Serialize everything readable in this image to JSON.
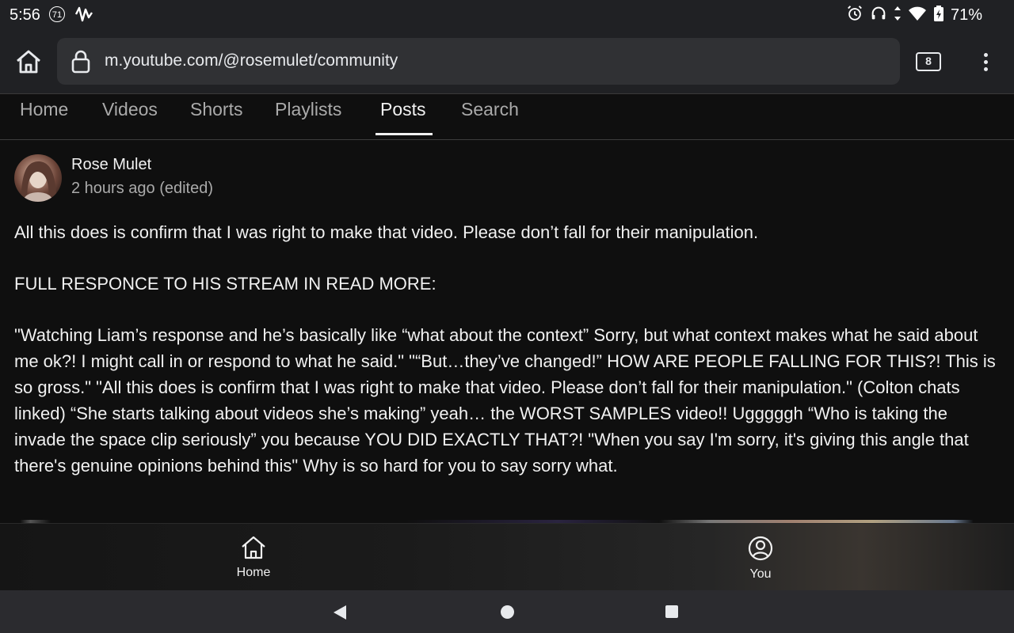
{
  "status_bar": {
    "time": "5:56",
    "notification_badge": "71",
    "battery": "71%",
    "icons": [
      "alarm-icon",
      "headphones-icon",
      "data-arrows-icon",
      "wifi-icon",
      "battery-charging-icon"
    ]
  },
  "browser": {
    "url": "m.youtube.com/@rosemulet/community",
    "tab_count": "8"
  },
  "channel_tabs": [
    {
      "label": "Home"
    },
    {
      "label": "Videos"
    },
    {
      "label": "Shorts"
    },
    {
      "label": "Playlists"
    },
    {
      "label": "Posts"
    },
    {
      "label": "Search"
    }
  ],
  "active_tab": "Posts",
  "post": {
    "author": "Rose Mulet",
    "time": "2 hours ago (edited)",
    "paragraphs": [
      "All this does is confirm that I was right to make that video. Please don’t fall for their manipulation.",
      "FULL RESPONCE TO HIS STREAM IN READ MORE:",
      "\"Watching Liam’s response and he’s basically like “what about the context” Sorry, but what context makes what he said about me ok?! I might call in or respond to what he said.\" \"“But…they’ve changed!” HOW ARE PEOPLE FALLING FOR THIS?! This is so gross.\" \"All this does is confirm that I was right to make that video. Please don’t fall for their manipulation.\" (Colton chats linked) “She starts talking about videos she’s making” yeah… the WORST SAMPLES video!! Ugggggh “Who is taking the invade the space clip seriously” you because YOU DID EXACTLY THAT?! \"When you say I'm sorry, it's giving this angle that there's genuine opinions behind this\" Why is so hard for you to say sorry what."
    ]
  },
  "bottom_nav": {
    "home_label": "Home",
    "you_label": "You"
  }
}
